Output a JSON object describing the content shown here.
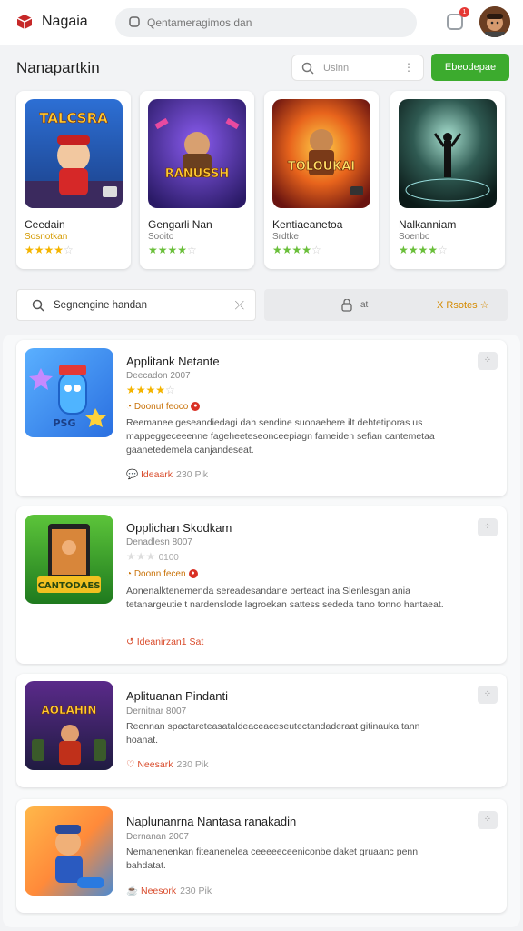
{
  "header": {
    "brand": "Nagaia",
    "search_placeholder": "Qentameragimos dan",
    "notification_count": "1"
  },
  "section": {
    "title": "Nanapartkin",
    "search_placeholder": "Usinn",
    "button_label": "Ebeodepae"
  },
  "featured": [
    {
      "art_text": "TALCSRA",
      "name": "Ceedain",
      "sub": "Sosnotkan",
      "rating": 4
    },
    {
      "art_text": "RANUSSH",
      "name": "Gengarli Nan",
      "sub": "Sooito",
      "rating": 4
    },
    {
      "art_text": "TOLOUKAI",
      "name": "Kentiaeanetoa",
      "sub": "Srdtke",
      "rating": 4
    },
    {
      "art_text": "",
      "name": "Nalkanniam",
      "sub": "Soenbo",
      "rating": 4
    }
  ],
  "filters": {
    "search_label": "Segnengine handan",
    "mid_label": "at",
    "rating_label": "X Rsotes"
  },
  "list": [
    {
      "title": "Applitank Netante",
      "meta": "Deecadon 2007",
      "rating": 4,
      "badge": "Doonut feoco",
      "desc": "Reemanee geseandiedagi dah sendine suonaehere ilt dehtetiporas us mappeggeceeenne fageheeteseonceepiagn fameiden sefian cantemetaa gaanetedemela canjandeseat.",
      "action": "Ideaark",
      "count": "230 Pik",
      "thumb_text": "PSG"
    },
    {
      "title": "Opplichan Skodkam",
      "meta": "Denadlesn 8007",
      "rating": 0,
      "rating_text": "0100",
      "badge": "Doonn fecen",
      "desc": "Aonenalktenemenda sereadesandane berteact ina Slenlesgan ania tetanargeutie t nardenslode lagroekan sattess sededa tano tonno hantaeat.",
      "action": "Ideanirzan1 Sat",
      "count": "",
      "thumb_text": "CANTODAES"
    },
    {
      "title": "Aplituanan Pindanti",
      "meta": "Dernitnar 8007",
      "rating": 0,
      "badge": "",
      "desc": "Reennan spactareteasataldeaceaceseutectandaderaat gitinauka tann hoanat.",
      "action": "Neesark",
      "count": "230 Pik",
      "thumb_text": "AOLAHIN"
    },
    {
      "title": "Naplunanrna Nantasa ranakadin",
      "meta": "Dernanan 2007",
      "rating": 0,
      "badge": "",
      "desc": "Nemanenenkan fiteanenelea ceeeeeceeniconbe daket gruaanc penn bahdatat.",
      "action": "Neesork",
      "count": "230 Pik",
      "thumb_text": ""
    }
  ],
  "colors": {
    "accent_green": "#3cab2e",
    "star": "#f4b400",
    "action": "#d94b2b"
  }
}
